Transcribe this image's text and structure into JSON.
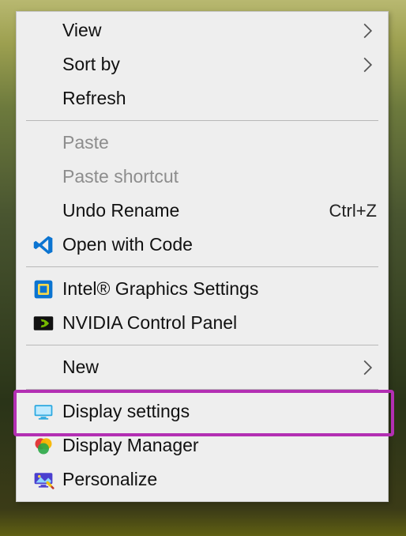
{
  "menu": {
    "view": {
      "label": "View"
    },
    "sort_by": {
      "label": "Sort by"
    },
    "refresh": {
      "label": "Refresh"
    },
    "paste": {
      "label": "Paste"
    },
    "paste_shortcut": {
      "label": "Paste shortcut"
    },
    "undo_rename": {
      "label": "Undo Rename",
      "accel": "Ctrl+Z"
    },
    "open_with_code": {
      "label": "Open with Code"
    },
    "intel_graphics": {
      "label": "Intel® Graphics Settings"
    },
    "nvidia_panel": {
      "label": "NVIDIA Control Panel"
    },
    "new": {
      "label": "New"
    },
    "display_settings": {
      "label": "Display settings"
    },
    "display_manager": {
      "label": "Display Manager"
    },
    "personalize": {
      "label": "Personalize"
    }
  },
  "highlight": {
    "target": "display_settings"
  }
}
